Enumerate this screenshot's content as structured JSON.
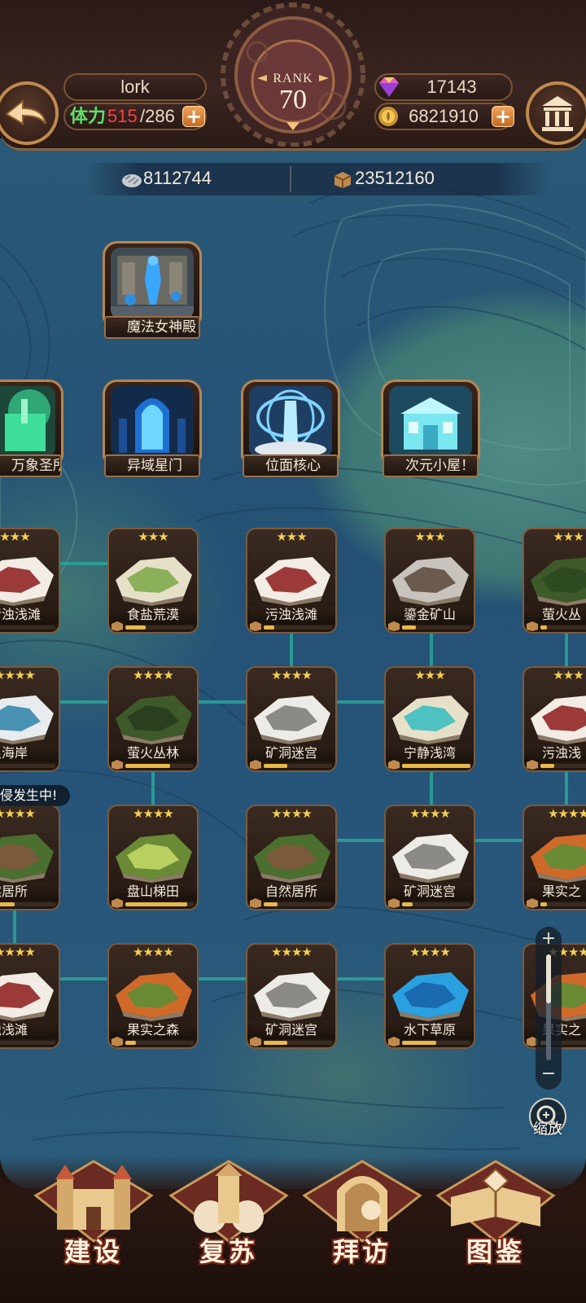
{
  "header": {
    "player_name": "lork",
    "stamina_label": "体力",
    "stamina_current": "515",
    "stamina_max": "/286",
    "rank_label": "RANK",
    "rank_value": "70",
    "gems": "17143",
    "gold": "6821910",
    "plus": "+"
  },
  "resources": {
    "stone": "8112744",
    "crates": "23512160"
  },
  "buildings": [
    {
      "label": "魔法女神殿"
    },
    {
      "label": "万象圣所"
    },
    {
      "label": "异域星门"
    },
    {
      "label": "位面核心"
    },
    {
      "label": "次元小屋！"
    }
  ],
  "tiles": {
    "row1": [
      {
        "label": "污浊浅滩",
        "stars": "★★★",
        "progress": 0.05
      },
      {
        "label": "食盐荒漠",
        "stars": "★★★",
        "progress": 0.3
      },
      {
        "label": "污浊浅滩",
        "stars": "★★★",
        "progress": 0.15
      },
      {
        "label": "鎏金矿山",
        "stars": "★★★",
        "progress": 0.2
      },
      {
        "label": "萤火丛",
        "stars": "★★★",
        "progress": 0.1
      }
    ],
    "row2": [
      {
        "label": "浪海岸",
        "stars": "★★★★",
        "progress": 0.1
      },
      {
        "label": "萤火丛林",
        "stars": "★★★★",
        "progress": 0.65
      },
      {
        "label": "矿洞迷宫",
        "stars": "★★★★",
        "progress": 0.35
      },
      {
        "label": "宁静浅湾",
        "stars": "★★★",
        "progress": 1.0
      },
      {
        "label": "污浊浅",
        "stars": "★★★",
        "progress": 0.2
      }
    ],
    "row3": [
      {
        "label": "然居所",
        "stars": "★★★★",
        "progress": 0.4
      },
      {
        "label": "盘山梯田",
        "stars": "★★★★",
        "progress": 0.9
      },
      {
        "label": "自然居所",
        "stars": "★★★★",
        "progress": 0.2
      },
      {
        "label": "矿洞迷宫",
        "stars": "★★★★",
        "progress": 0.15
      },
      {
        "label": "果实之",
        "stars": "★★★★",
        "progress": 0.1
      }
    ],
    "row4": [
      {
        "label": "浊浅滩",
        "stars": "★★★★",
        "progress": 0.1
      },
      {
        "label": "果实之森",
        "stars": "★★★★",
        "progress": 0.15
      },
      {
        "label": "矿洞迷宫",
        "stars": "★★★★",
        "progress": 0.35
      },
      {
        "label": "水下草原",
        "stars": "★★★★",
        "progress": 0.5
      },
      {
        "label": "果实之",
        "stars": "★★★★",
        "progress": 0.1
      }
    ]
  },
  "invasion_banner": "侵发生中!",
  "zoom": {
    "plus": "+",
    "minus": "−",
    "label": "缩放"
  },
  "nav": [
    {
      "label": "建设"
    },
    {
      "label": "复苏"
    },
    {
      "label": "拜访"
    },
    {
      "label": "图鉴"
    }
  ],
  "colors": {
    "accent_gold": "#c08a4e",
    "stamina_red": "#ff4040",
    "star_yellow": "#f4cf52",
    "connector_teal": "#2aa59a"
  }
}
